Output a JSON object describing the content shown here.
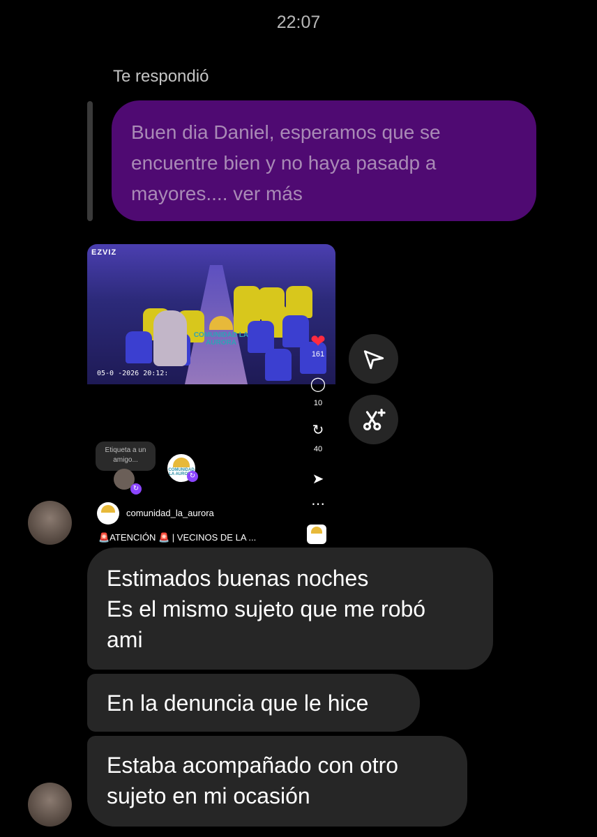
{
  "chat": {
    "timestamp": "22:07",
    "reply_label": "Te respondió",
    "quoted_message": "Buen dia Daniel, esperamos que se encuentre bien y no haya pasadp a mayores.... ver más"
  },
  "shared_post": {
    "video_overlay_brand": "EZVIZ",
    "video_overlay_time": "05-0 -2026 20:12:",
    "watermark_text": "COMUNIDAD LA AURORA",
    "likes": "161",
    "comments": "10",
    "reposts": "40",
    "tag_prompt": "Etiqueta a un amigo...",
    "account": "comunidad_la_aurora",
    "caption": "🚨ATENCIÓN 🚨 | VECINOS DE LA ...",
    "logo_text": "COMUNIDAD LA AURORA"
  },
  "messages": [
    {
      "text": "Estimados buenas noches\nEs el mismo sujeto que me robó\nami"
    },
    {
      "text": "En la denuncia que le hice"
    },
    {
      "text": "Estaba acompañado con otro\nsujeto en mi ocasión"
    }
  ],
  "icons": {
    "send": "paper-plane-icon",
    "ai": "sparkle-scissors-icon",
    "like": "heart-icon",
    "comment": "comment-icon",
    "repost": "repost-icon",
    "share": "paper-plane-icon",
    "more": "more-icon"
  },
  "colors": {
    "background": "#000000",
    "outgoing_bubble": "#4f0a72",
    "incoming_bubble": "#262626",
    "like_red": "#ff2b40",
    "accent_purple": "#8b45ff"
  }
}
